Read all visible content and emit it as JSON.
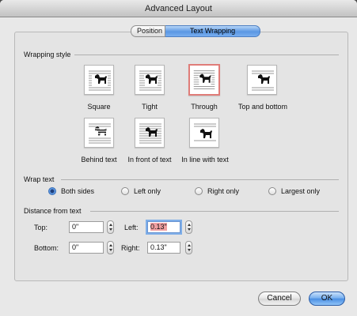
{
  "window": {
    "title": "Advanced Layout"
  },
  "tabs": [
    {
      "label": "Position",
      "active": false
    },
    {
      "label": "Text Wrapping",
      "active": true
    }
  ],
  "wrapping_style": {
    "heading": "Wrapping style",
    "selected": "Through",
    "options": [
      {
        "label": "Square",
        "icon": "wrap-square-icon"
      },
      {
        "label": "Tight",
        "icon": "wrap-tight-icon"
      },
      {
        "label": "Through",
        "icon": "wrap-through-icon"
      },
      {
        "label": "Top and bottom",
        "icon": "wrap-top-bottom-icon"
      },
      {
        "label": "Behind text",
        "icon": "wrap-behind-text-icon"
      },
      {
        "label": "In front of text",
        "icon": "wrap-in-front-icon"
      },
      {
        "label": "In line with text",
        "icon": "wrap-inline-icon"
      }
    ]
  },
  "wrap_text": {
    "heading": "Wrap text",
    "selected": "Both sides",
    "options": [
      "Both sides",
      "Left only",
      "Right only",
      "Largest only"
    ]
  },
  "distance": {
    "heading": "Distance from text",
    "top": {
      "label": "Top:",
      "value": "0\""
    },
    "bottom": {
      "label": "Bottom:",
      "value": "0\""
    },
    "left": {
      "label": "Left:",
      "value": "0.13\""
    },
    "right": {
      "label": "Right:",
      "value": "0.13\""
    }
  },
  "buttons": {
    "cancel": "Cancel",
    "ok": "OK"
  },
  "colors": {
    "selection_border": "#e07c78",
    "default_button": "#4a8fe3",
    "active_tab": "#5a97e3"
  }
}
